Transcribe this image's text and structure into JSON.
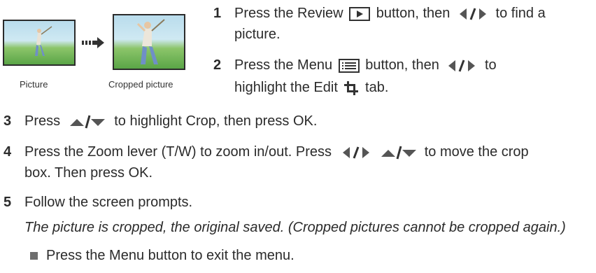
{
  "figure": {
    "caption_left": "Picture",
    "caption_right": "Cropped picture"
  },
  "steps": [
    {
      "num": "1",
      "part1": "Press the Review",
      "part2": "button, then",
      "part3": "to find a",
      "line2": "picture."
    },
    {
      "num": "2",
      "part1": "Press the Menu",
      "part2": "button, then",
      "part3": "to",
      "line2a": "highlight the Edit",
      "line2b": "tab."
    },
    {
      "num": "3",
      "part1": "Press",
      "part2": "to highlight Crop, then press OK."
    },
    {
      "num": "4",
      "part1": "Press the Zoom lever (T/W) to zoom in/out. Press",
      "part2": "to move the crop",
      "line2": "box. Then press OK."
    },
    {
      "num": "5",
      "part1": "Follow the screen prompts."
    }
  ],
  "note": "The picture is cropped, the original saved. (Cropped pictures cannot be cropped again.)",
  "bullet": "Press the Menu button to exit the menu.",
  "icons": [
    "review-icon",
    "left-right-icon",
    "menu-icon",
    "edit-crop-icon",
    "up-down-icon"
  ]
}
